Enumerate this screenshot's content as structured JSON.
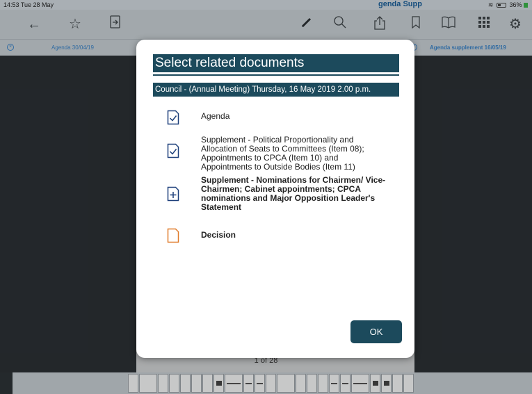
{
  "status_bar": {
    "time": "14:53 Tue 28 May",
    "battery": "36%",
    "background_peek_text": "genda Supp"
  },
  "toolbar": {
    "icons": [
      "back-arrow-icon",
      "star-icon",
      "export-page-icon",
      "pencil-icon",
      "search-icon",
      "share-icon",
      "bookmark-icon",
      "book-icon",
      "grid-icon",
      "gear-icon"
    ]
  },
  "doc_tabs": {
    "left_label": "Agenda 30/04/19",
    "right_label": "Agenda supplement 16/05/19"
  },
  "viewer": {
    "page_counter": "1 of 28"
  },
  "modal": {
    "title": "Select related documents",
    "meeting": "Council - (Annual Meeting) Thursday, 16 May 2019 2.00 p.m.",
    "documents": [
      {
        "label": "Agenda",
        "icon": "document-check-icon",
        "state": "selected",
        "color": "#1c3f7a",
        "bold": false
      },
      {
        "label": "Supplement - Political Proportionality and Allocation of Seats to Committees (Item 08); Appointments to CPCA (Item 10) and Appointments to Outside Bodies (Item 11)",
        "icon": "document-check-icon",
        "state": "selected",
        "color": "#1c3f7a",
        "bold": false
      },
      {
        "label": "Supplement - Nominations for Chairmen/ Vice-Chairmen; Cabinet appointments; CPCA nominations and Major Opposition Leader's Statement",
        "icon": "document-add-icon",
        "state": "add",
        "color": "#1c3f7a",
        "bold": true
      },
      {
        "label": "Decision",
        "icon": "document-icon",
        "state": "current",
        "color": "#e07b2a",
        "bold": true
      }
    ],
    "ok_label": "OK"
  },
  "colors": {
    "accent": "#1c4a5c",
    "link_blue": "#3b83c6",
    "decision_orange": "#e07b2a"
  }
}
